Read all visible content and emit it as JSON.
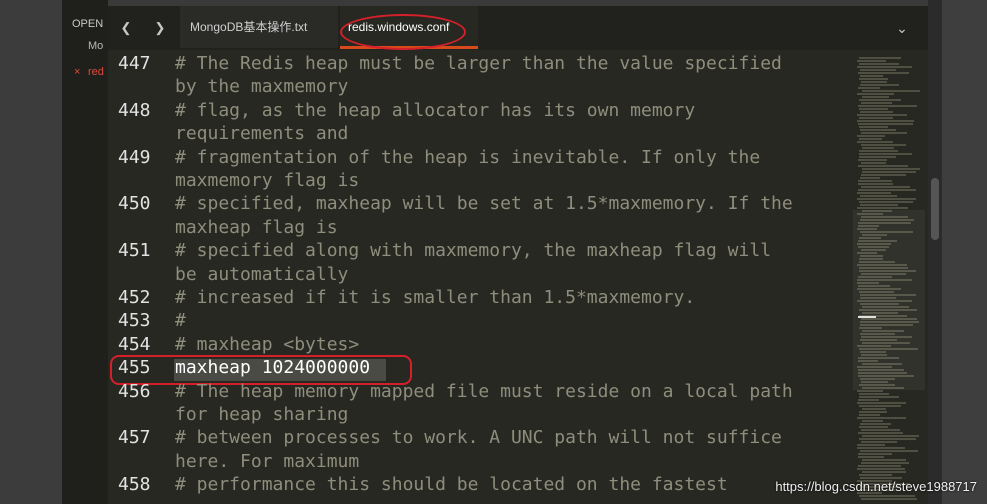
{
  "sidebar": {
    "open_label": "OPEN",
    "items": [
      "Mo",
      "red"
    ],
    "close_glyph": "×"
  },
  "tabbar": {
    "back_icon": "chevron-left-icon",
    "forward_icon": "chevron-right-icon",
    "tabs": [
      {
        "label": "MongoDB基本操作.txt",
        "active": false
      },
      {
        "label": "redis.windows.conf",
        "active": true
      }
    ],
    "dropdown_icon": "chevron-down-icon",
    "accent": "#d64a1c"
  },
  "editor": {
    "lines": [
      {
        "num": "447",
        "text": "# The Redis heap must be larger than the value specified"
      },
      {
        "num": "",
        "text": "by the maxmemory"
      },
      {
        "num": "448",
        "text": "# flag, as the heap allocator has its own memory"
      },
      {
        "num": "",
        "text": "requirements and"
      },
      {
        "num": "449",
        "text": "# fragmentation of the heap is inevitable. If only the"
      },
      {
        "num": "",
        "text": "maxmemory flag is"
      },
      {
        "num": "450",
        "text": "# specified, maxheap will be set at 1.5*maxmemory. If the"
      },
      {
        "num": "",
        "text": "maxheap flag is"
      },
      {
        "num": "451",
        "text": "# specified along with maxmemory, the maxheap flag will"
      },
      {
        "num": "",
        "text": "be automatically"
      },
      {
        "num": "452",
        "text": "# increased if it is smaller than 1.5*maxmemory."
      },
      {
        "num": "453",
        "text": "#"
      },
      {
        "num": "454",
        "text": "# maxheap <bytes>"
      },
      {
        "num": "455",
        "text": "maxheap 1024000000",
        "active": true
      },
      {
        "num": "456",
        "text": "# The heap memory mapped file must reside on a local path"
      },
      {
        "num": "",
        "text": "for heap sharing"
      },
      {
        "num": "457",
        "text": "# between processes to work. A UNC path will not suffice"
      },
      {
        "num": "",
        "text": "here. For maximum"
      },
      {
        "num": "458",
        "text": "# performance this should be located on the fastest"
      }
    ]
  },
  "watermark": "https://blog.csdn.net/steve1988717",
  "colors": {
    "editor_bg": "#272822",
    "comment": "#8f8d7c",
    "annotation_ring": "#d4202a"
  }
}
